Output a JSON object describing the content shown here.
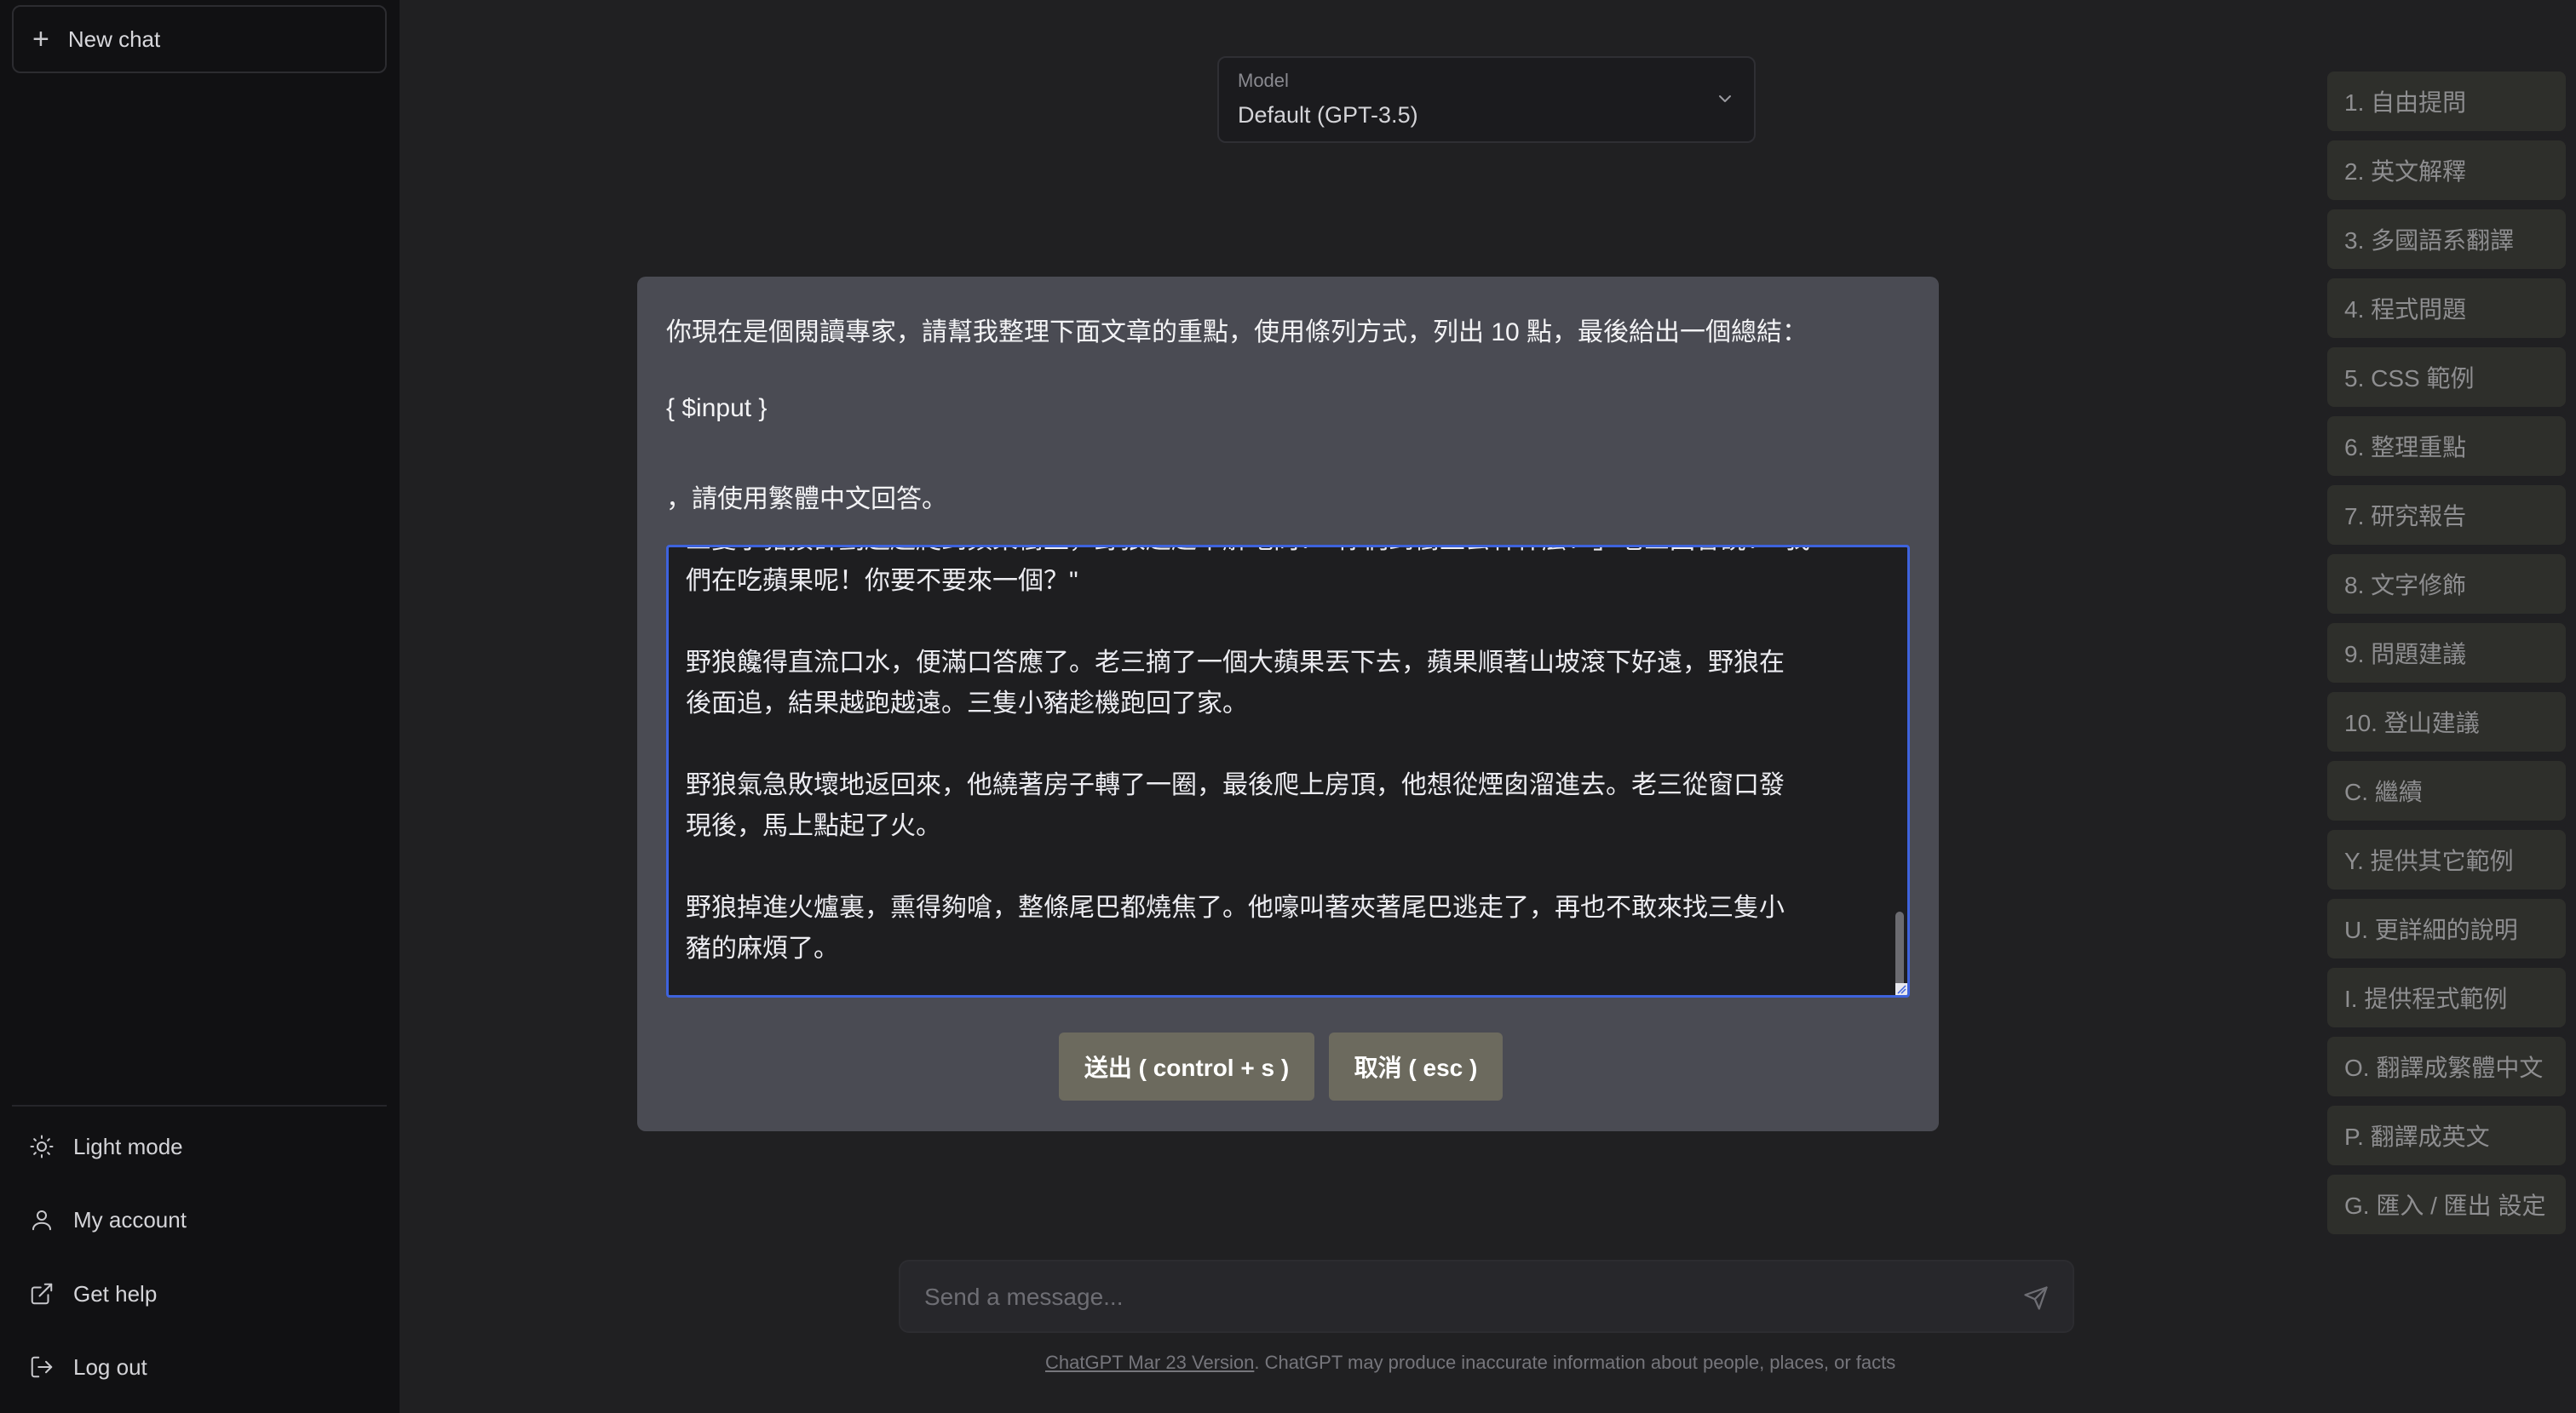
{
  "sidebar": {
    "new_chat": "New chat",
    "light_mode": "Light mode",
    "my_account": "My account",
    "get_help": "Get help",
    "log_out": "Log out"
  },
  "model": {
    "label": "Model",
    "value": "Default (GPT-3.5)"
  },
  "quick_buttons": [
    "1. 自由提問",
    "2. 英文解釋",
    "3. 多國語系翻譯",
    "4. 程式問題",
    "5. CSS 範例",
    "6. 整理重點",
    "7. 研究報告",
    "8. 文字修飾",
    "9. 問題建議",
    "10. 登山建議",
    "C. 繼續",
    "Y. 提供其它範例",
    "U. 更詳細的說明",
    "I. 提供程式範例",
    "O. 翻譯成繁體中文",
    "P. 翻譯成英文",
    "G. 匯入 / 匯出 設定"
  ],
  "modal": {
    "prompt_line1": "你現在是個閱讀專家，請幫我整理下面文章的重點，使用條列方式，列出 10 點，最後給出一個總結：",
    "prompt_line2": "{ $input }",
    "prompt_line3": "，請使用繁體中文回答。",
    "textarea_lines": [
      "三隻小豬按計劃趁趁爬到蘋果樹上，野狼趕趕不解地問：「你們到樹上去幹什麼？」老三回答說：「我",
      "們在吃蘋果呢！你要不要來一個？\"",
      "野狼饞得直流口水，便滿口答應了。老三摘了一個大蘋果丟下去，蘋果順著山坡滾下好遠，野狼在",
      "後面追，結果越跑越遠。三隻小豬趁機跑回了家。",
      "野狼氣急敗壞地返回來，他繞著房子轉了一圈，最後爬上房頂，他想從煙囱溜進去。老三從窗口發",
      "現後，馬上點起了火。",
      "野狼掉進火爐裏，熏得夠嗆，整條尾巴都燒焦了。他嚎叫著夾著尾巴逃走了，再也不敢來找三隻小",
      "豬的麻煩了。"
    ],
    "submit_label": "送出 ( control + s )",
    "cancel_label": "取消 ( esc )"
  },
  "composer": {
    "placeholder": "Send a message..."
  },
  "footer": {
    "link_text": "ChatGPT Mar 23 Version",
    "text": ". ChatGPT may produce inaccurate information about people, places, or facts"
  },
  "colors": {
    "accent_border": "#3e63dd",
    "modal_bg": "#4a4b53",
    "button_bg": "#6c6a5e"
  }
}
